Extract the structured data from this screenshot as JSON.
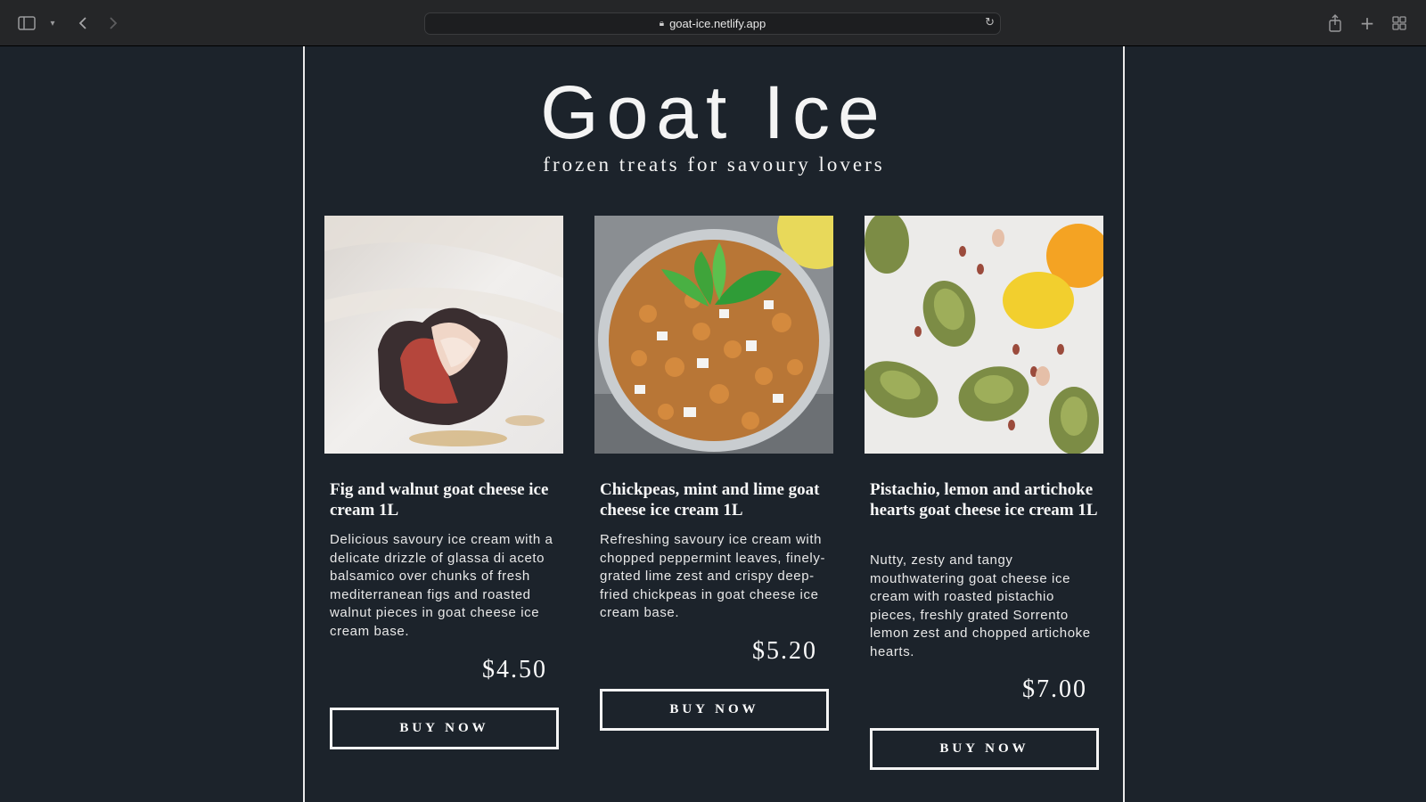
{
  "browser": {
    "url": "goat-ice.netlify.app"
  },
  "site": {
    "title": "Goat Ice",
    "tagline": "frozen treats for savoury lovers"
  },
  "products": [
    {
      "name": "Fig and walnut goat cheese ice cream 1L",
      "description": "Delicious savoury ice cream with a delicate drizzle of glassa di aceto balsamico over chunks of fresh mediterranean figs and roasted walnut pieces in goat cheese ice cream base.",
      "price": "$4.50",
      "button": "BUY NOW",
      "image_icon": "fig-image"
    },
    {
      "name": "Chickpeas, mint and lime goat cheese ice cream 1L",
      "description": "Refreshing savoury ice cream with chopped peppermint leaves, finely-grated lime zest and crispy deep-fried chickpeas in goat cheese ice cream base.",
      "price": "$5.20",
      "button": "BUY NOW",
      "image_icon": "chickpea-salad-image"
    },
    {
      "name": "Pistachio, lemon and artichoke hearts goat cheese ice cream 1L",
      "description": "Nutty, zesty and tangy mouthwatering goat cheese ice cream with roasted pistachio pieces, freshly grated Sorrento lemon zest and chopped artichoke hearts.",
      "price": "$7.00",
      "button": "BUY NOW",
      "image_icon": "artichoke-lemon-image"
    }
  ],
  "colors": {
    "background": "#1c232b",
    "text": "#ffffff",
    "border": "#e9e9e9"
  }
}
